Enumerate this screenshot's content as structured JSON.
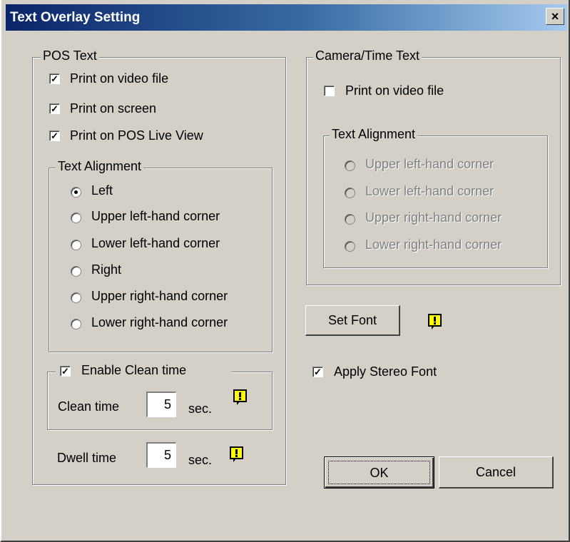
{
  "window": {
    "title": "Text Overlay Setting",
    "close_label": "×"
  },
  "pos_text": {
    "legend": "POS Text",
    "checks": [
      {
        "label": "Print on video file",
        "checked": true
      },
      {
        "label": "Print on screen",
        "checked": true
      },
      {
        "label": "Print on POS Live View",
        "checked": true
      }
    ],
    "alignment": {
      "legend": "Text Alignment",
      "options": [
        "Left",
        "Upper left-hand corner",
        "Lower left-hand corner",
        "Right",
        "Upper right-hand corner",
        "Lower right-hand corner"
      ],
      "selected": "Left"
    },
    "clean": {
      "enable_label": "Enable Clean time",
      "enabled": true,
      "time_label": "Clean time",
      "value": "5",
      "unit": "sec."
    },
    "dwell": {
      "label": "Dwell time",
      "value": "5",
      "unit": "sec."
    }
  },
  "camera_text": {
    "legend": "Camera/Time Text",
    "print_label": "Print on video file",
    "print_checked": false,
    "alignment": {
      "legend": "Text Alignment",
      "options": [
        "Upper left-hand corner",
        "Lower left-hand corner",
        "Upper right-hand corner",
        "Lower right-hand corner"
      ],
      "enabled": false
    }
  },
  "font": {
    "set_font_label": "Set Font",
    "stereo_label": "Apply Stereo Font",
    "stereo_checked": true
  },
  "buttons": {
    "ok": "OK",
    "cancel": "Cancel"
  },
  "icons": {
    "warning": "warning-icon",
    "warning_color": "#ffff00"
  }
}
